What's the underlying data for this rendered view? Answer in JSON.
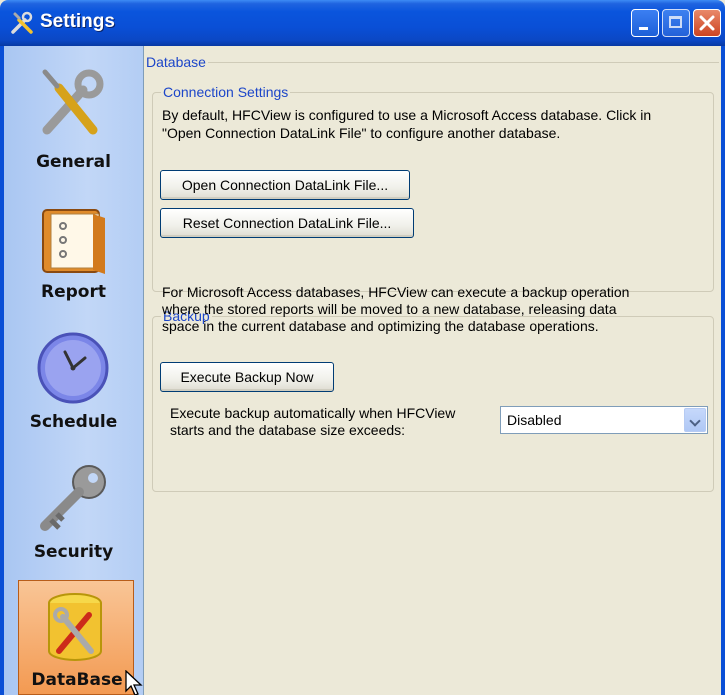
{
  "window": {
    "title": "Settings",
    "icon": "tools-icon",
    "controls": [
      "minimize-button",
      "maximize-button",
      "close-button"
    ],
    "title_color": "#0a4fd6"
  },
  "sidebar": {
    "items": [
      {
        "label": "General",
        "icon": "wrench-screwdriver-icon"
      },
      {
        "label": "Report",
        "icon": "binder-icon"
      },
      {
        "label": "Schedule",
        "icon": "clock-icon"
      },
      {
        "label": "Security",
        "icon": "key-icon"
      },
      {
        "label": "DataBase",
        "icon": "database-tools-icon",
        "selected": true
      }
    ],
    "selected_color": "#f5a25d"
  },
  "content": {
    "group_title": "Database",
    "connection": {
      "title": "Connection Settings",
      "description_line1": "By default, HFCView is configured to use a Microsoft Access database. Click in",
      "description_line2": "\"Open Connection DataLink File\" to configure another database.",
      "open_button": "Open Connection DataLink File...",
      "reset_button": "Reset Connection DataLink File..."
    },
    "backup": {
      "title": "Backup",
      "description_line1": "For Microsoft Access databases, HFCView can execute a backup operation",
      "description_line2": "where the stored reports will be moved to a new database, releasing data",
      "description_line3": "space in the current database and optimizing the database operations.",
      "execute_button": "Execute Backup Now",
      "auto_label_line1": "Execute backup automatically when HFCView",
      "auto_label_line2": "starts and the database size exceeds:",
      "auto_value": "Disabled"
    }
  }
}
